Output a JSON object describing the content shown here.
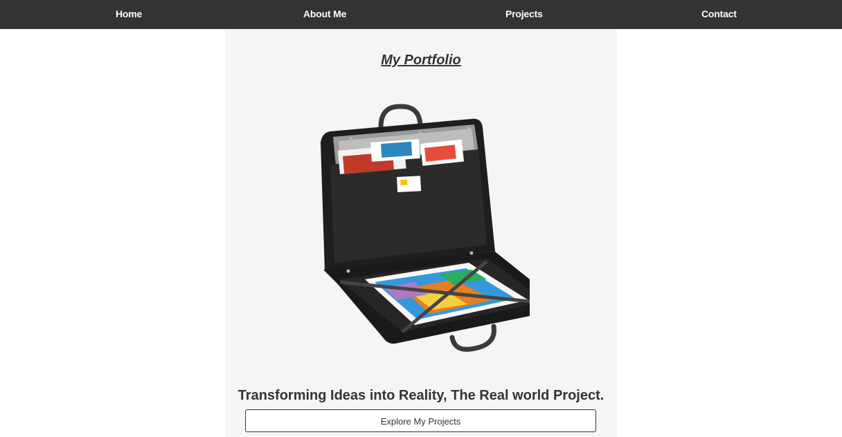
{
  "nav": {
    "home": "Home",
    "about": "About Me",
    "projects": "Projects",
    "contact": "Contact"
  },
  "hero": {
    "title": "My Portfolio",
    "image_icon": "portfolio-case-image",
    "tagline": "Transforming Ideas into Reality, The Real world Project.",
    "cta_label": "Explore My Projects"
  },
  "colors": {
    "nav_bg": "#333333",
    "nav_text": "#ffffff",
    "panel_bg": "#f5f5f5",
    "text": "#333333"
  }
}
